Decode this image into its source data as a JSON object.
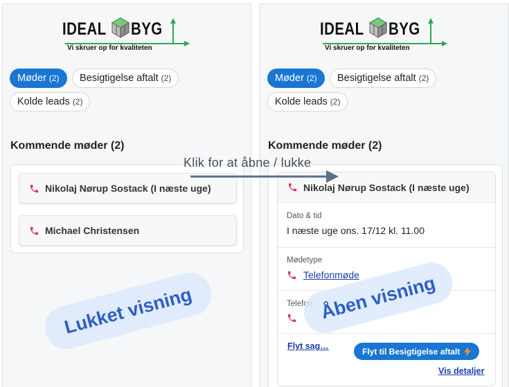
{
  "logo": {
    "word_left": "IDEAL",
    "word_right": "BYG",
    "tagline": "Vi skruer op for kvaliteten"
  },
  "tabs": [
    {
      "label": "Møder",
      "count": "(2)",
      "active": true
    },
    {
      "label": "Besigtigelse aftalt",
      "count": "(2)",
      "active": false
    },
    {
      "label": "Kolde leads",
      "count": "(2)",
      "active": false
    }
  ],
  "section_title": "Kommende møder (2)",
  "meetings": [
    {
      "name": "Nikolaj Nørup Sostack (I næste uge)"
    },
    {
      "name": "Michael Christensen"
    }
  ],
  "expanded": {
    "header": "Nikolaj Nørup Sostack (I næste uge)",
    "date_label": "Dato & tid",
    "date_value": "I næste uge ons. 17/12 kl. 11.00",
    "type_label": "Mødetype",
    "type_value": "Telefonmøde",
    "phone_label": "Telefon",
    "move_case_link": "Flyt sag…",
    "move_button": "Flyt til Besigtigelse aftalt",
    "details_link": "Vis detaljer"
  },
  "annotation": {
    "click_hint": "Klik for at åbne / lukke",
    "closed_view": "Lukket visning",
    "open_view": "Åben visning"
  },
  "icons": {
    "phone": "phone-icon",
    "bolt": "lightning-icon",
    "cube": "logo-cube-icon"
  },
  "colors": {
    "primary": "#1976d2",
    "phone": "#d6336c",
    "link": "#1a3ea8",
    "logo_green": "#2fa84f",
    "stamp_text": "#2d5fc4"
  }
}
